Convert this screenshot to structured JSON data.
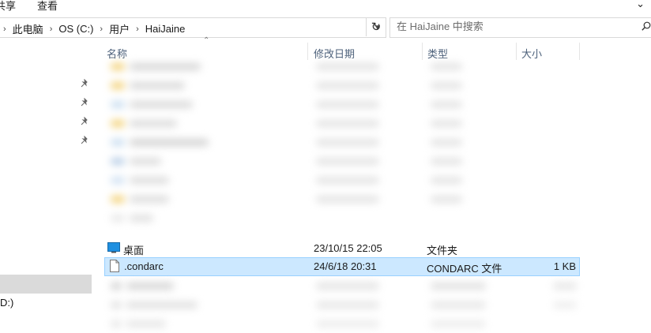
{
  "ribbon": {
    "tabs": [
      "共享",
      "查看"
    ]
  },
  "addressbar": {
    "breadcrumbs": [
      "此电脑",
      "OS (C:)",
      "用户",
      "HaiJaine"
    ]
  },
  "search": {
    "placeholder": "在 HaiJaine 中搜索"
  },
  "columns": {
    "name": "名称",
    "date": "修改日期",
    "type": "类型",
    "size": "大小"
  },
  "nav": {
    "drive_label": "D:)"
  },
  "files": [
    {
      "name": "桌面",
      "date": "23/10/15 22:05",
      "type": "文件夹",
      "size": "",
      "icon": "desktop-folder-icon",
      "selected": false
    },
    {
      "name": ".condarc",
      "date": "24/6/18 20:31",
      "type": "CONDARC 文件",
      "size": "1 KB",
      "icon": "file-icon",
      "selected": true
    }
  ],
  "colors": {
    "selection_bg": "#cce8ff",
    "selection_border": "#99d1ff",
    "header_text": "#4c607a",
    "folder_blue": "#1e8fe0"
  }
}
